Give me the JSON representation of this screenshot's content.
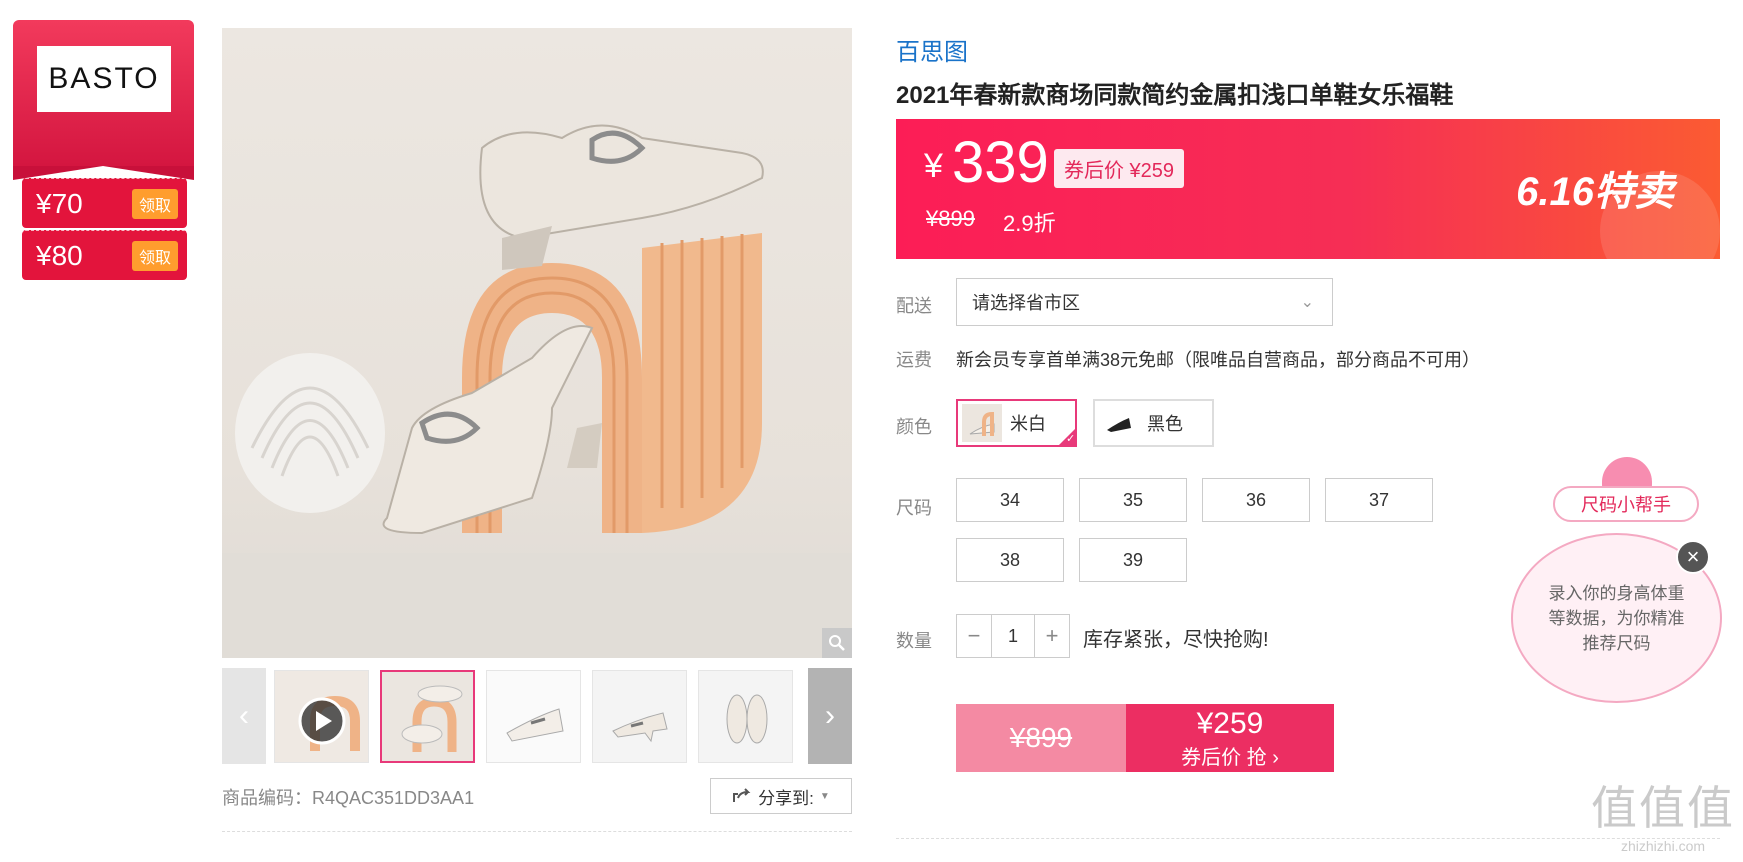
{
  "brand": {
    "logo_text": "BASTO",
    "coupons": [
      {
        "value": "¥70",
        "claim_label": "领取"
      },
      {
        "value": "¥80",
        "claim_label": "领取"
      }
    ]
  },
  "gallery": {
    "sku_label": "商品编码：R4QAC351DD3AA1",
    "share_label": "分享到:"
  },
  "product": {
    "brand_link": "百思图",
    "title": "2021年春新款商场同款简约金属扣浅口单鞋女乐福鞋"
  },
  "price": {
    "currency": "¥",
    "current": "339",
    "coupon_price_tag": "券后价 ¥259",
    "original": "¥899",
    "discount": "2.9折",
    "promo_badge": "6.16特卖"
  },
  "delivery": {
    "label": "配送",
    "region_placeholder": "请选择省市区"
  },
  "shipping": {
    "label": "运费",
    "text": "新会员专享首单满38元免邮（限唯品自营商品，部分商品不可用）"
  },
  "color": {
    "label": "颜色",
    "options": [
      {
        "name": "米白",
        "selected": true
      },
      {
        "name": "黑色",
        "selected": false
      }
    ]
  },
  "size": {
    "label": "尺码",
    "options": [
      "34",
      "35",
      "36",
      "37",
      "38",
      "39"
    ]
  },
  "quantity": {
    "label": "数量",
    "value": "1",
    "minus": "−",
    "plus": "+",
    "stock_text": "库存紧张，尽快抢购!"
  },
  "buy": {
    "original": "¥899",
    "price": "¥259",
    "sub_label": "券后价 抢 ›"
  },
  "size_helper": {
    "title": "尺码小帮手",
    "tip": "录入你的身高体重等数据，为你精准推荐尺码",
    "close": "×"
  },
  "watermark": {
    "main": "值值值",
    "sub": "zhizhizhi.com"
  },
  "colors": {
    "accent": "#e8397a",
    "banner": "#fc1d56",
    "link": "#1a73c9"
  }
}
